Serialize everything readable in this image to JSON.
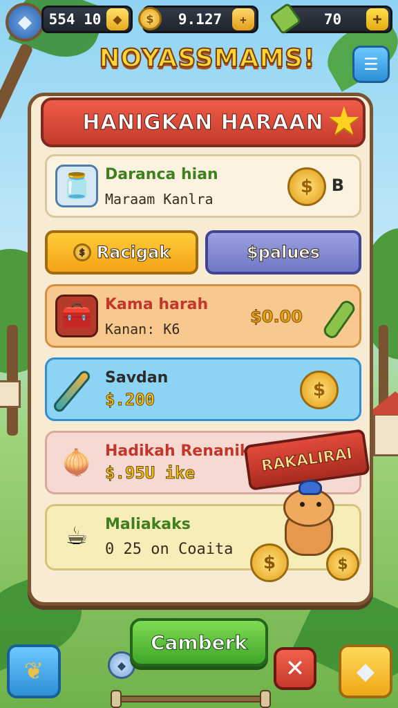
{
  "topbar": {
    "gems": "554 10",
    "gold": "9.127",
    "energy": "70",
    "plus": "+"
  },
  "title": "NOYASSMAMS!",
  "panel": {
    "header": "HANIGKAN HARAAN",
    "tab_left": "Racigak",
    "tab_right": "$palues",
    "items": [
      {
        "name": "Daranca hian",
        "sub": "Maraam Kanlra",
        "price": "B",
        "name_color": "#3f7f1f"
      },
      {
        "name": "Kama harah",
        "sub": "Kanan: K6",
        "price": "$0.00",
        "name_color": "#c3362a"
      },
      {
        "name": "Savdan",
        "sub": "$.200",
        "price": "",
        "name_color": "#2b2b2b"
      },
      {
        "name": "Hadikah Renanik",
        "sub": "$.95U ike",
        "price": "",
        "name_color": "#c3362a"
      },
      {
        "name": "Maliakaks",
        "sub": "0 25 on Coaita",
        "price": "",
        "name_color": "#3f7f1f"
      }
    ],
    "ribbon": "RAKALIRAI"
  },
  "bottom": {
    "cta": "Camberk"
  },
  "colors": {
    "accent_red": "#d8473a",
    "accent_green": "#4cb42f",
    "accent_gold": "#e6a413",
    "panel_bg": "#f7ecd3"
  },
  "icons": [
    "shield-icon",
    "gem-icon",
    "gold-coin-icon",
    "energy-icon",
    "plus-icon",
    "menu-icon",
    "star-icon",
    "jar-icon",
    "chest-icon",
    "brush-icon",
    "onion-icon",
    "teacup-icon",
    "carrot-icon",
    "close-icon",
    "gem-crystal-icon",
    "leaf-icon"
  ]
}
